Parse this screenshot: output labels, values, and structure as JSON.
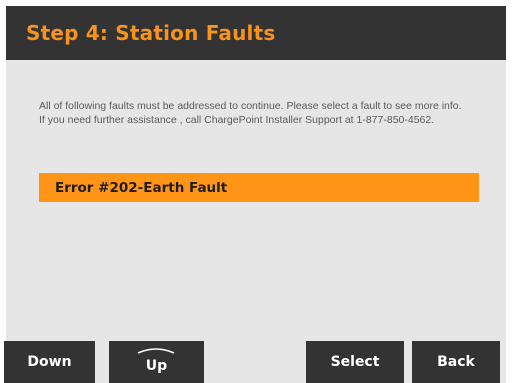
{
  "header": {
    "title": "Step 4: Station Faults"
  },
  "instructions": {
    "line1": "All of following faults must be addressed to continue. Please select a fault to see more info.",
    "line2": "If you need further assistance , call ChargePoint Installer Support at 1-877-850-4562."
  },
  "faults": [
    {
      "label": "Error #202-Earth Fault",
      "selected": true
    }
  ],
  "softkeys": {
    "down": "Down",
    "up": "Up",
    "select": "Select",
    "back": "Back"
  },
  "colors": {
    "accent": "#f7931e",
    "header_bg": "#333333",
    "screen_bg": "#e6e6e6",
    "selected_row": "#ff9416"
  }
}
